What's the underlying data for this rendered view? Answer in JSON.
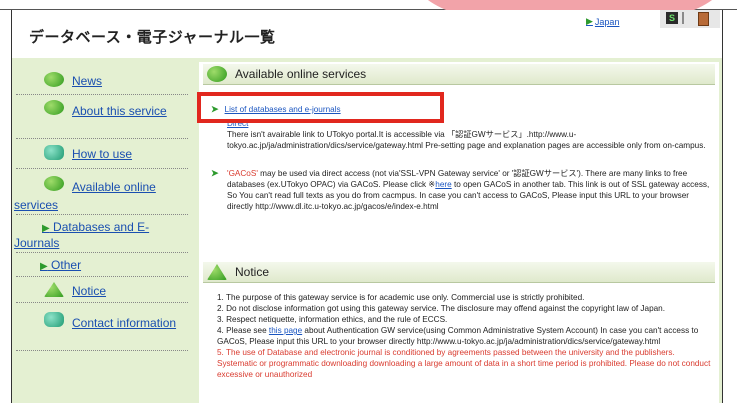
{
  "header": {
    "title": "データベース・電子ジャーナル一覧",
    "language_link": "Japan"
  },
  "sidebar": {
    "items": [
      {
        "label": "News"
      },
      {
        "label": "About this service"
      },
      {
        "label": "How to use"
      },
      {
        "label": "Available online services"
      },
      {
        "label": "Databases and E-Journals"
      },
      {
        "label": "Other"
      },
      {
        "label": "Notice"
      },
      {
        "label": "Contact information"
      }
    ]
  },
  "main": {
    "services_title": "Available online services",
    "services": [
      {
        "label": "List of databases and e-journals"
      },
      {
        "label": "Direct",
        "note": "There isn't avairable link to UTokyo portal.It is accessible via 「認証GWサービス」.http://www.u-tokyo.ac.jp/ja/administration/dics/service/gateway.html Pre-setting page and explanation pages are accessible only from on-campus."
      },
      {
        "pre": "'GACoS'",
        "text1": " may be used via direct access (not via'SSL-VPN Gateway service' or '認証GWサービス'). There are many links to free databases (ex.UTokyo OPAC) via GACoS. Please click ※",
        "link": "here",
        "text2": " to open GACoS in another tab. This link is out of SSL gateway access, So You can't read full texts as you do from cacmpus. In case you can't access to GACoS, Please input this URL to your browser directly http://www.dl.itc.u-tokyo.ac.jp/gacos/e/index-e.html"
      }
    ],
    "notice_title": "Notice",
    "notices": [
      {
        "n": "1.",
        "text": "The purpose of this gateway service is for academic use only. Commercial use is strictly prohibited."
      },
      {
        "n": "2.",
        "text": "Do not disclose information got using this gateway service. The disclosure may offend against the copyright law of Japan."
      },
      {
        "n": "3.",
        "text": "Respect netiquette, information ethics, and the rule of ECCS."
      },
      {
        "n": "4.",
        "pre": "Please see ",
        "link": "this page",
        "text": " about Authentication GW service(using Common Administrative System Account) In case you can't access to GACoS, Please input this URL to your browser directly http://www.u-tokyo.ac.jp/ja/administration/dics/service/gateway.html"
      },
      {
        "n": "5.",
        "text": "The use of Database and electronic journal is conditioned by agreements passed between the university and the publishers. Systematic or programmatic downloading downloading a large amount of data in a short time period is prohibited. Please do not conduct excessive or unauthorized"
      }
    ]
  },
  "colors": {
    "sidebar_bg": "#e4f0d2",
    "link": "#1a55c0",
    "highlight_box": "#e1271e",
    "callout": "#f2a3a9",
    "notice_red": "#d93b2f"
  },
  "icons": {
    "news": "speech-bubble-icon",
    "about": "speech-bubble-icon",
    "how_to_use": "monitor-icon",
    "available": "globe-icon",
    "notice": "warning-triangle-icon",
    "contact": "envelope-icon"
  }
}
